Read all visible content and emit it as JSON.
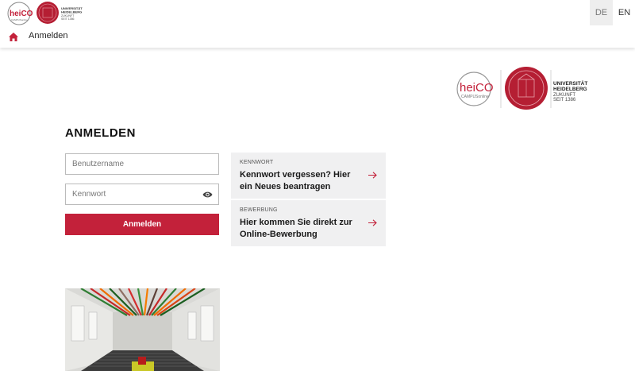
{
  "header": {
    "logo_heico": "heiCO",
    "logo_campus": "CAMPUSonline",
    "logo_uni_1": "UNIVERSITÄT",
    "logo_uni_2": "HEIDELBERG",
    "logo_uni_3": "ZUKUNFT",
    "logo_uni_4": "SEIT 1386",
    "languages": [
      "DE",
      "EN"
    ],
    "active_language": "DE",
    "breadcrumb": "Anmelden"
  },
  "main": {
    "title": "ANMELDEN",
    "username_placeholder": "Benutzername",
    "password_placeholder": "Kennwort",
    "login_button": "Anmelden",
    "cards": [
      {
        "kicker": "KENNWORT",
        "link": "Kennwort vergessen? Hier ein Neues beantragen"
      },
      {
        "kicker": "BEWERBUNG",
        "link": "Hier kommen Sie direkt zur Online-Bewerbung"
      }
    ]
  },
  "colors": {
    "accent": "#c3213a",
    "seal": "#b51e33",
    "card_bg": "#f0f0f1"
  },
  "icons": [
    "home-icon",
    "eye-icon",
    "arrow-right-icon"
  ]
}
